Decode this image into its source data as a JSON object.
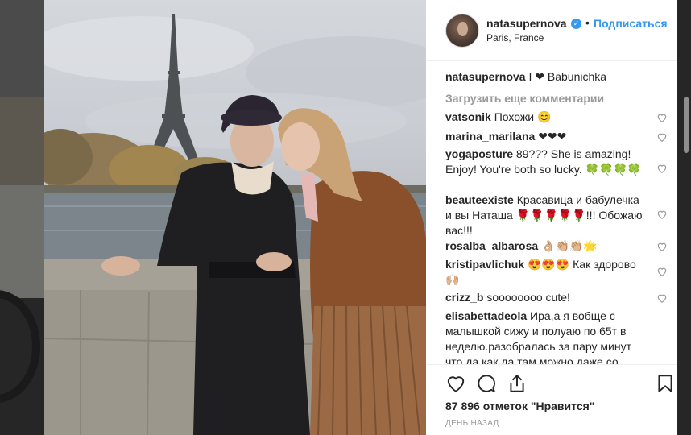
{
  "post": {
    "username": "natasupernova",
    "follow_label": "Подписаться",
    "location": "Paris, France",
    "caption_user": "natasupernova",
    "caption_text": "I ❤ Babunichka",
    "load_more": "Загрузить еще комментарии",
    "likes": "87 896 отметок \"Нравится\"",
    "time": "ДЕНЬ НАЗАД"
  },
  "comments": [
    {
      "user": "vatsonik",
      "text": "Похожи 😊"
    },
    {
      "user": "marina_marilana",
      "text": "❤❤❤"
    },
    {
      "user": "yogaposture",
      "text": "89??? She is amazing! Enjoy! You're both so lucky. 🍀🍀🍀🍀"
    },
    {
      "user": "beauteexiste",
      "text": "Красавица и бабулечка и вы Наташа 🌹🌹🌹🌹🌹!!! Обожаю вас!!!"
    },
    {
      "user": "rosalba_albarosa",
      "text": "👌🏼👏🏼👏🏼🌟"
    },
    {
      "user": "kristipavlichuk",
      "text": "😍😍😍 Как здорово 🙌🏼"
    },
    {
      "user": "crizz_b",
      "text": "soooooooo cute!"
    },
    {
      "user": "elisabettadeola",
      "text": "Ира,а я вобще с малышкой сижу и полуаю по 65т в неделю.разобралась за пару минут что да как,да там можно даже со"
    }
  ],
  "colors": {
    "accent": "#3897f0",
    "muted": "#999999",
    "text": "#262626"
  },
  "icons": [
    "verified-badge-icon",
    "heart-icon",
    "comment-icon",
    "share-icon",
    "bookmark-icon"
  ]
}
